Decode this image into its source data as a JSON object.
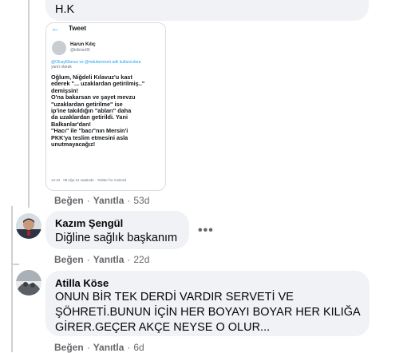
{
  "top_comment": {
    "text_tail": "H.K",
    "tweet_image": {
      "header_title": "Tweet",
      "author_name": "Harun Kılıç",
      "author_handle": "@kilictar06",
      "reply_mentions": "@OlcayKilavuz ve @mdutarresmi adlı kullanıcılara",
      "reply_suffix": "yanıt olarak",
      "body_lines": [
        "Oğlum, Niğdeli Kılavuz'u kast",
        "ederek \"... uzaklardan getirilmiş..\"",
        "demişsin!",
        "O'na bakarsan ve şayet mevzu",
        "\"uzaklardan getirilme\" ise",
        "ip'ine takıldığın \"abları\" daha",
        "da uzaklardan getirildi. Yani",
        "Balkanlar'dan!",
        "\"Hacı\" ile \"bacı\"nın Mersin'i",
        "PKK'ya teslim etmesini asla",
        "unutmayacağız!"
      ],
      "footer": "12:42 · 08 Ağu 21 saatinde · Twitter for Android"
    },
    "actions": {
      "like": "Beğen",
      "reply": "Yanıtla",
      "time": "53d"
    }
  },
  "comments": [
    {
      "author": "Kazım Şengül",
      "text_lines": [
        "Diğline sağlık başkanım"
      ],
      "more_icon": "more-horizontal-icon",
      "actions": {
        "like": "Beğen",
        "reply": "Yanıtla",
        "time": "22d"
      }
    },
    {
      "author": "Atilla Köse",
      "text_lines": [
        "ONUN BİR TEK DERDİ VARDIR SERVETİ VE",
        "ŞÖHRETİ.BUNUN İÇİN HER BOYAYI BOYAR HER KILIĞA",
        "GİRER.GEÇER AKÇE NEYSE O OLUR..."
      ],
      "actions": {
        "like": "Beğen",
        "reply": "Yanıtla",
        "time": "6d"
      }
    }
  ],
  "colors": {
    "bubble": "#f0f2f5",
    "secondary_text": "#65676b",
    "thread_line": "#ced0d4",
    "twitter_blue": "#1da1f2"
  }
}
